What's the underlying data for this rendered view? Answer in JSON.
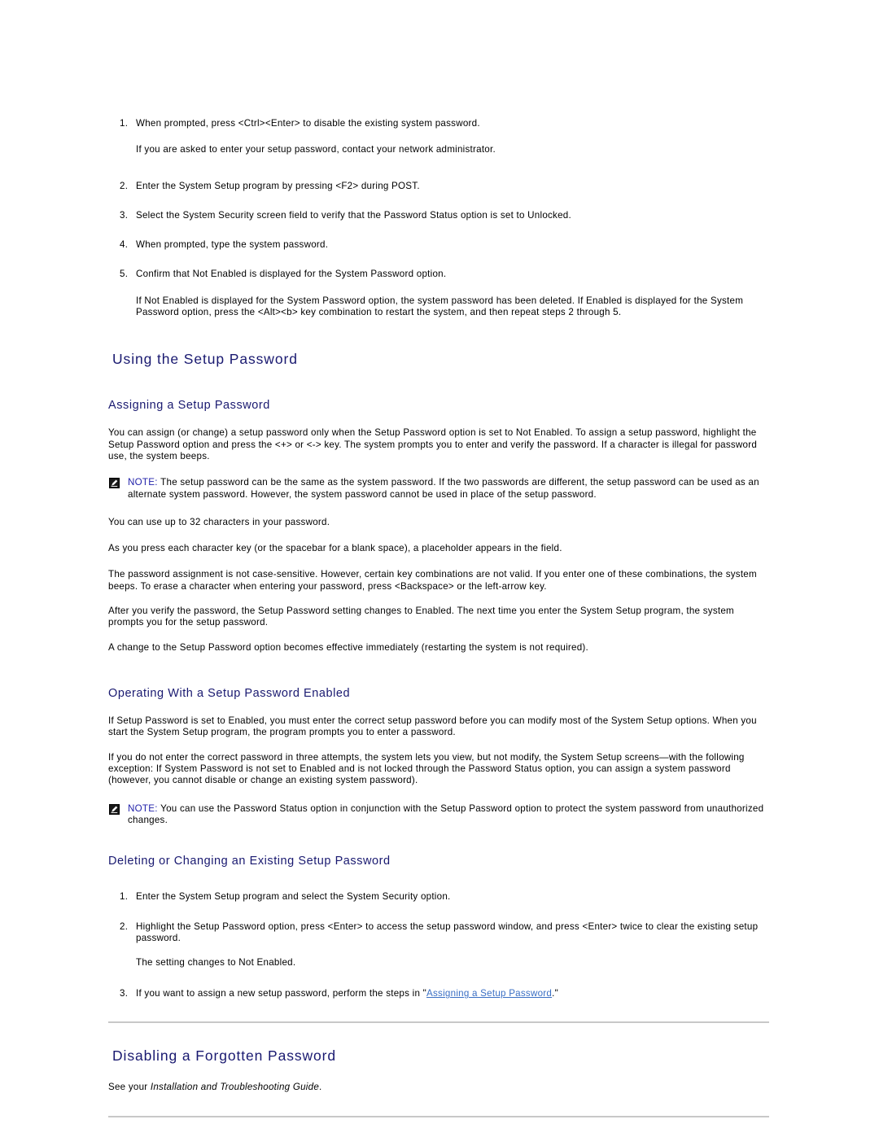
{
  "intro_steps": [
    {
      "num": "1.",
      "text": "When prompted, press <Ctrl><Enter> to disable the existing system password.",
      "sub": "If you are asked to enter your setup password, contact your network administrator."
    },
    {
      "num": "2.",
      "text": "Enter the System Setup program by pressing <F2> during POST.",
      "sub": ""
    },
    {
      "num": "3.",
      "text": "Select the System Security screen field to verify that the Password Status option is set to Unlocked.",
      "sub": ""
    },
    {
      "num": "4.",
      "text": "When prompted, type the system password.",
      "sub": ""
    },
    {
      "num": "5.",
      "text": "Confirm that Not Enabled is displayed for the System Password option.",
      "sub": "If Not Enabled is displayed for the System Password option, the system password has been deleted. If Enabled is displayed for the System Password option, press the <Alt><b> key combination to restart the system, and then repeat steps 2 through 5."
    }
  ],
  "section_using_setup_password": {
    "heading": "Using the Setup Password",
    "assigning": {
      "heading": "Assigning a Setup Password",
      "para1": "You can assign (or change) a setup password only when the Setup Password option is set to Not Enabled. To assign a setup password, highlight the Setup Password option and press the <+> or <-> key. The system prompts you to enter and verify the password. If a character is illegal for password use, the system beeps.",
      "note": {
        "label": "NOTE:",
        "text": "The setup password can be the same as the system password. If the two passwords are different, the setup password can be used as an alternate system password. However, the system password cannot be used in place of the setup password."
      },
      "para2": "You can use up to 32 characters in your password.",
      "para3": "As you press each character key (or the spacebar for a blank space), a placeholder appears in the field.",
      "para4": "The password assignment is not case-sensitive. However, certain key combinations are not valid. If you enter one of these combinations, the system beeps. To erase a character when entering your password, press <Backspace> or the left-arrow key.",
      "para5": "After you verify the password, the Setup Password setting changes to Enabled. The next time you enter the System Setup program, the system prompts you for the setup password.",
      "para6": "A change to the Setup Password option becomes effective immediately (restarting the system is not required)."
    },
    "operating": {
      "heading": "Operating With a Setup Password Enabled",
      "para1": "If Setup Password is set to Enabled, you must enter the correct setup password before you can modify most of the System Setup options. When you start the System Setup program, the program prompts you to enter a password.",
      "para2": "If you do not enter the correct password in three attempts, the system lets you view, but not modify, the System Setup screens—with the following exception: If System Password is not set to Enabled and is not locked through the Password Status option, you can assign a system password (however, you cannot disable or change an existing system password).",
      "note": {
        "label": "NOTE:",
        "text": "You can use the Password Status option in conjunction with the Setup Password option to protect the system password from unauthorized changes."
      }
    },
    "deleting": {
      "heading": "Deleting or Changing an Existing Setup Password",
      "steps": [
        {
          "num": "1.",
          "text": "Enter the System Setup program and select the System Security option.",
          "sub": ""
        },
        {
          "num": "2.",
          "text": "Highlight the Setup Password option, press <Enter> to access the setup password window, and press <Enter> twice to clear the existing setup password.",
          "sub": "The setting changes to Not Enabled."
        }
      ],
      "step3": {
        "num": "3.",
        "prefix": "If you want to assign a new setup password, perform the steps in \"",
        "link": "Assigning a Setup Password",
        "suffix": ".\""
      }
    }
  },
  "section_disabling": {
    "heading": "Disabling a Forgotten Password",
    "text_prefix": "See your ",
    "text_italic": "Installation and Troubleshooting Guide",
    "text_suffix": "."
  },
  "colors": {
    "heading_blue": "#191970",
    "note_label_blue": "#2222aa",
    "link_blue": "#3a6fc4",
    "rule_gray": "#c8c8c8",
    "body_black": "#000000"
  },
  "icons": {
    "note": "pencil-note-icon"
  }
}
